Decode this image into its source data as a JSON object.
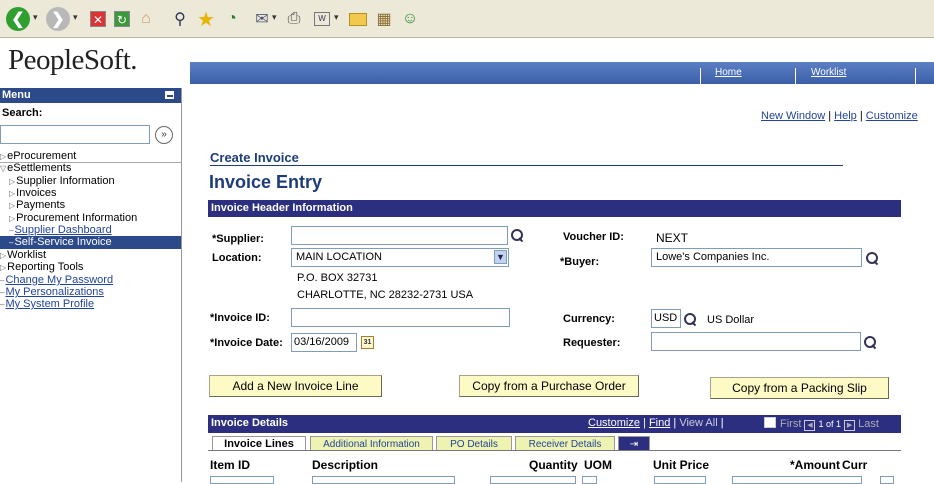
{
  "toolbar": {
    "icons": [
      "back-icon",
      "forward-icon",
      "stop-icon",
      "refresh-icon",
      "home-icon",
      "search-icon",
      "favorites-icon",
      "history-icon",
      "mail-icon",
      "print-icon",
      "edit-icon",
      "folder-icon",
      "research-icon",
      "messenger-icon"
    ]
  },
  "header": {
    "logo": "PeopleSoft.",
    "nav": {
      "home": "Home",
      "worklist": "Worklist"
    }
  },
  "sidebar": {
    "title": "Menu",
    "search_label": "Search:",
    "search_value": "",
    "go_glyph": "»",
    "items": [
      {
        "label": "eProcurement",
        "indent": 0,
        "marker": "▷",
        "type": "folder"
      },
      {
        "label": "eSettlements",
        "indent": 0,
        "marker": "▽",
        "type": "folder"
      },
      {
        "label": "Supplier Information",
        "indent": 1,
        "marker": "▷",
        "type": "folder"
      },
      {
        "label": "Invoices",
        "indent": 1,
        "marker": "▷",
        "type": "folder"
      },
      {
        "label": "Payments",
        "indent": 1,
        "marker": "▷",
        "type": "folder"
      },
      {
        "label": "Procurement Information",
        "indent": 1,
        "marker": "▷",
        "type": "folder"
      },
      {
        "label": "Supplier Dashboard",
        "indent": 1,
        "marker": "–",
        "type": "link"
      },
      {
        "label": "Self-Service Invoice",
        "indent": 1,
        "marker": "–",
        "type": "selected"
      },
      {
        "label": "Worklist",
        "indent": 0,
        "marker": "▷",
        "type": "folder"
      },
      {
        "label": "Reporting Tools",
        "indent": 0,
        "marker": "▷",
        "type": "folder"
      },
      {
        "label": "Change My Password",
        "indent": 0,
        "marker": "–",
        "type": "link"
      },
      {
        "label": "My Personalizations",
        "indent": 0,
        "marker": "–",
        "type": "link"
      },
      {
        "label": "My System Profile",
        "indent": 0,
        "marker": "–",
        "type": "link"
      }
    ]
  },
  "toplinks": {
    "new_window": "New Window",
    "sep": "|",
    "help": "Help",
    "customize": "Customize"
  },
  "page": {
    "subtitle": "Create Invoice",
    "title": "Invoice Entry",
    "header_section": "Invoice Header Information"
  },
  "form": {
    "supplier_label": "*Supplier:",
    "supplier_value": "",
    "voucher_label": "Voucher ID:",
    "voucher_value": "NEXT",
    "location_label": "Location:",
    "location_value": "MAIN LOCATION",
    "buyer_label": "*Buyer:",
    "buyer_value": "Lowe's Companies Inc.",
    "address_line1": "P.O. BOX 32731",
    "address_line2": "CHARLOTTE, NC  28232-2731  USA",
    "invoice_id_label": "*Invoice ID:",
    "invoice_id_value": "",
    "currency_label": "Currency:",
    "currency_value": "USD",
    "currency_desc": "US Dollar",
    "invoice_date_label": "*Invoice Date:",
    "invoice_date_value": "03/16/2009",
    "calendar_glyph": "31",
    "requester_label": "Requester:",
    "requester_value": ""
  },
  "buttons": {
    "add_line": "Add a New Invoice Line",
    "copy_po": "Copy from a Purchase Order",
    "copy_packing": "Copy from a Packing Slip"
  },
  "details": {
    "title": "Invoice Details",
    "customize": "Customize",
    "sep1": "|",
    "find": "Find",
    "sep2": "|",
    "view_all": "View All",
    "sep3": "|",
    "first": "First",
    "pager": "1 of 1",
    "last": "Last",
    "tabs": [
      "Invoice Lines",
      "Additional Information",
      "PO Details",
      "Receiver Details"
    ],
    "columns": [
      "Item ID",
      "Description",
      "Quantity",
      "UOM",
      "Unit Price",
      "*Amount",
      "Curr"
    ]
  }
}
